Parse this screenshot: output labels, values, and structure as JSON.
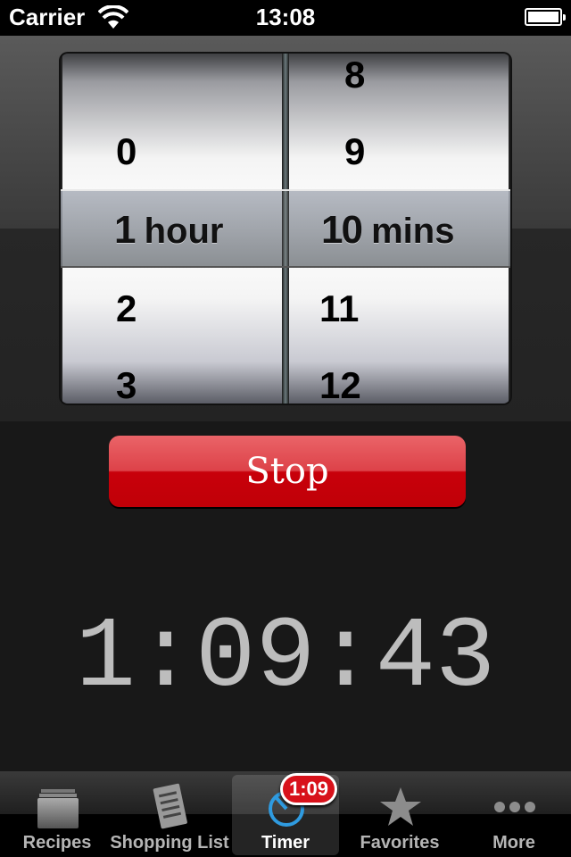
{
  "status_bar": {
    "carrier": "Carrier",
    "time": "13:08"
  },
  "picker": {
    "hours": {
      "above": [
        "0"
      ],
      "selected_value": "1",
      "selected_unit": "hour",
      "below": [
        "2",
        "3"
      ]
    },
    "minutes": {
      "above": [
        "8",
        "9"
      ],
      "selected_value": "10",
      "selected_unit": "mins",
      "below": [
        "11",
        "12"
      ]
    }
  },
  "stop_button": {
    "label": "Stop",
    "color": "#c8000a"
  },
  "countdown": "1:09:43",
  "tab_bar": {
    "items": [
      {
        "label": "Recipes",
        "icon": "recipe-box-icon"
      },
      {
        "label": "Shopping List",
        "icon": "shopping-list-icon"
      },
      {
        "label": "Timer",
        "icon": "timer-icon",
        "badge": "1:09",
        "active": true
      },
      {
        "label": "Favorites",
        "icon": "star-icon"
      },
      {
        "label": "More",
        "icon": "more-dots-icon"
      }
    ]
  }
}
